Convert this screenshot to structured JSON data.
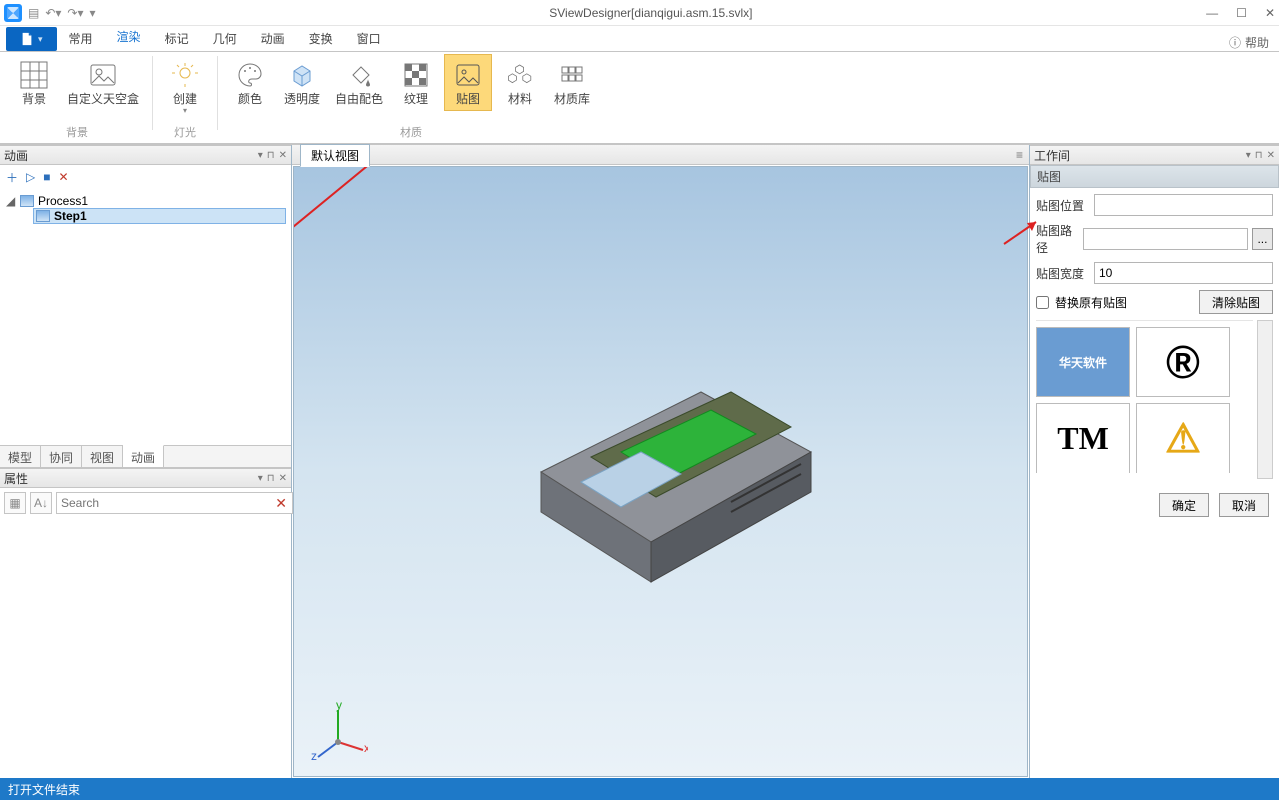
{
  "title": "SViewDesigner[dianqigui.asm.15.svlx]",
  "help": "帮助",
  "ribbon_tabs": [
    "常用",
    "渲染",
    "标记",
    "几何",
    "动画",
    "变换",
    "窗口"
  ],
  "active_tab": 1,
  "ribbon": {
    "groups": [
      {
        "label": "背景",
        "items": [
          {
            "id": "bg",
            "caption": "背景"
          },
          {
            "id": "skybox",
            "caption": "自定义天空盒"
          }
        ]
      },
      {
        "label": "灯光",
        "items": [
          {
            "id": "create",
            "caption": "创建",
            "dropdown": true
          }
        ]
      },
      {
        "label": "材质",
        "items": [
          {
            "id": "color",
            "caption": "颜色"
          },
          {
            "id": "opacity",
            "caption": "透明度"
          },
          {
            "id": "freecolor",
            "caption": "自由配色"
          },
          {
            "id": "texture",
            "caption": "纹理"
          },
          {
            "id": "map",
            "caption": "贴图",
            "selected": true
          },
          {
            "id": "material",
            "caption": "材料"
          },
          {
            "id": "matlib",
            "caption": "材质库"
          }
        ]
      }
    ]
  },
  "left": {
    "panel_title": "动画",
    "tree_root": "Process1",
    "tree_child": "Step1",
    "tabs": [
      "模型",
      "协同",
      "视图",
      "动画"
    ],
    "active_left_tab": 3,
    "props_title": "属性",
    "search_placeholder": "Search"
  },
  "center": {
    "tab": "默认视图"
  },
  "right": {
    "panel_title": "工作间",
    "sub_title": "贴图",
    "fields": {
      "position_label": "贴图位置",
      "position_value": "",
      "path_label": "贴图路径",
      "path_value": "",
      "width_label": "贴图宽度",
      "width_value": "10"
    },
    "replace_label": "替换原有贴图",
    "clear_btn": "清除贴图",
    "thumbs": [
      "华天软件",
      "®",
      "TM",
      "⚠"
    ],
    "ok": "确定",
    "cancel": "取消"
  },
  "status": "打开文件结束"
}
